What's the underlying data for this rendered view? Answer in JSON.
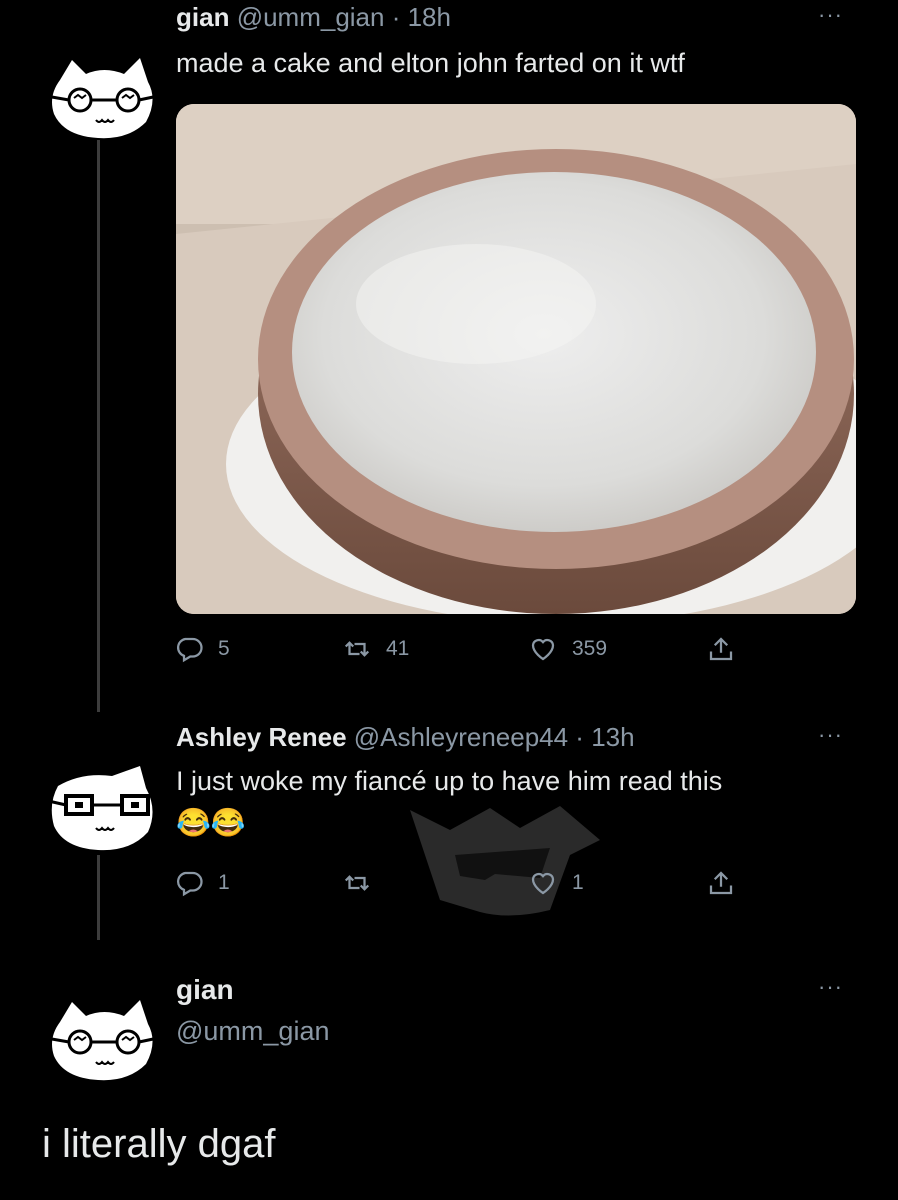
{
  "tweets": [
    {
      "name": "gian",
      "handle": "@umm_gian",
      "sep": " · ",
      "time": "18h",
      "text": "made a cake and elton john farted on it wtf",
      "more": "···",
      "counts": {
        "reply": "5",
        "retweet": "41",
        "like": "359"
      }
    },
    {
      "name": "Ashley Renee",
      "handle": "@Ashleyreneep44",
      "sep": " · ",
      "time": "13h",
      "text": "I just woke my fiancé up to have him read this",
      "emoji": "😂😂",
      "more": "···",
      "counts": {
        "reply": "1",
        "retweet": "",
        "like": "1"
      }
    },
    {
      "name": "gian",
      "handle": "@umm_gian",
      "text": "i literally dgaf",
      "more": "···"
    }
  ],
  "icons": [
    "reply-icon",
    "retweet-icon",
    "like-icon",
    "share-icon",
    "more-icon"
  ],
  "colors": {
    "background": "#000000",
    "text": "#e7e9ea",
    "muted": "#8b98a5",
    "thread_line": "#3d3d3d"
  }
}
